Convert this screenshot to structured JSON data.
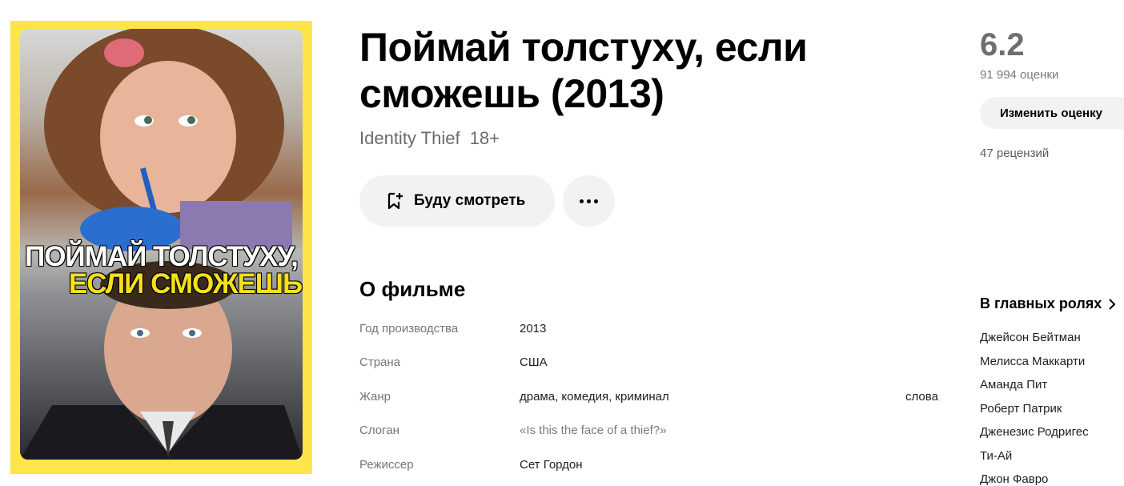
{
  "poster": {
    "title_line1": "ПОЙМАЙ ТОЛСТУХУ,",
    "title_line2": "ЕСЛИ СМОЖЕШЬ"
  },
  "film": {
    "title": "Поймай толстуху, если сможешь (2013)",
    "original_title": "Identity Thief",
    "age_rating": "18+"
  },
  "actions": {
    "watch_label": "Буду смотреть",
    "watch_icon": "bookmark-plus-icon",
    "more_icon": "more-dots-icon"
  },
  "about": {
    "title": "О фильме",
    "rows": [
      {
        "label": "Год производства",
        "value": "2013"
      },
      {
        "label": "Страна",
        "value": "США"
      },
      {
        "label": "Жанр",
        "value": "драма, комедия, криминал",
        "extra": "слова"
      },
      {
        "label": "Слоган",
        "value": "«Is this the face of a thief?»"
      },
      {
        "label": "Режиссер",
        "value": "Сет Гордон"
      }
    ]
  },
  "rating": {
    "score": "6.2",
    "votes": "91 994 оценки",
    "change_label": "Изменить оценку",
    "reviews": "47 рецензий"
  },
  "cast": {
    "title": "В главных ролях",
    "actors": [
      "Джейсон Бейтман",
      "Мелисса Маккарти",
      "Аманда Пит",
      "Роберт Патрик",
      "Дженезис Родригес",
      "Ти-Ай",
      "Джон Фавро"
    ]
  },
  "colors": {
    "poster_frame": "#fde54a",
    "button_bg": "#f2f2f2",
    "rating_gray": "#6e6e6e"
  }
}
